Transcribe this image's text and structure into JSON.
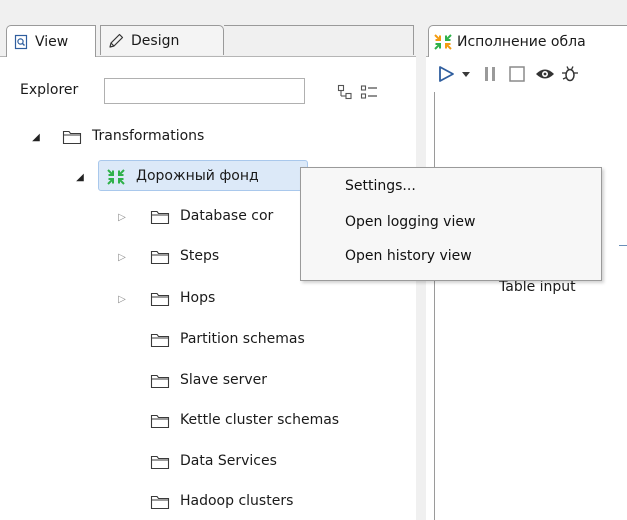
{
  "left_panel": {
    "tabs": [
      {
        "label": "View",
        "icon": "view-icon",
        "active": true
      },
      {
        "label": "Design",
        "icon": "pencil-icon",
        "active": false
      }
    ],
    "explorer": {
      "label": "Explorer",
      "search_value": "",
      "buttons": [
        "expand-tree-icon",
        "list-view-icon"
      ]
    },
    "tree": {
      "root": {
        "label": "Transformations",
        "expanded": true
      },
      "transformation": {
        "label": "Дорожный фонд",
        "expanded": true,
        "selected": true
      },
      "children": [
        {
          "label": "Database cor",
          "expandable": true
        },
        {
          "label": "Steps",
          "expandable": true
        },
        {
          "label": "Hops",
          "expandable": true
        },
        {
          "label": "Partition schemas",
          "expandable": false
        },
        {
          "label": "Slave server",
          "expandable": false
        },
        {
          "label": "Kettle cluster schemas",
          "expandable": false
        },
        {
          "label": "Data Services",
          "expandable": false
        },
        {
          "label": "Hadoop clusters",
          "expandable": false
        }
      ]
    }
  },
  "right_panel": {
    "tab": {
      "label": "Исполнение обла"
    },
    "toolbar": [
      "run-icon",
      "dropdown-icon",
      "pause-icon",
      "stop-icon",
      "preview-icon",
      "debug-icon"
    ],
    "canvas": {
      "step_label": "Table input"
    }
  },
  "context_menu": {
    "items": [
      "Settings...",
      "Open logging view",
      "Open history view"
    ]
  },
  "colors": {
    "selection_bg": "#dce9f8",
    "selection_border": "#a9c8ec",
    "transformation_icon": "#2fb14a",
    "run_icon": "#2f5e9e"
  }
}
